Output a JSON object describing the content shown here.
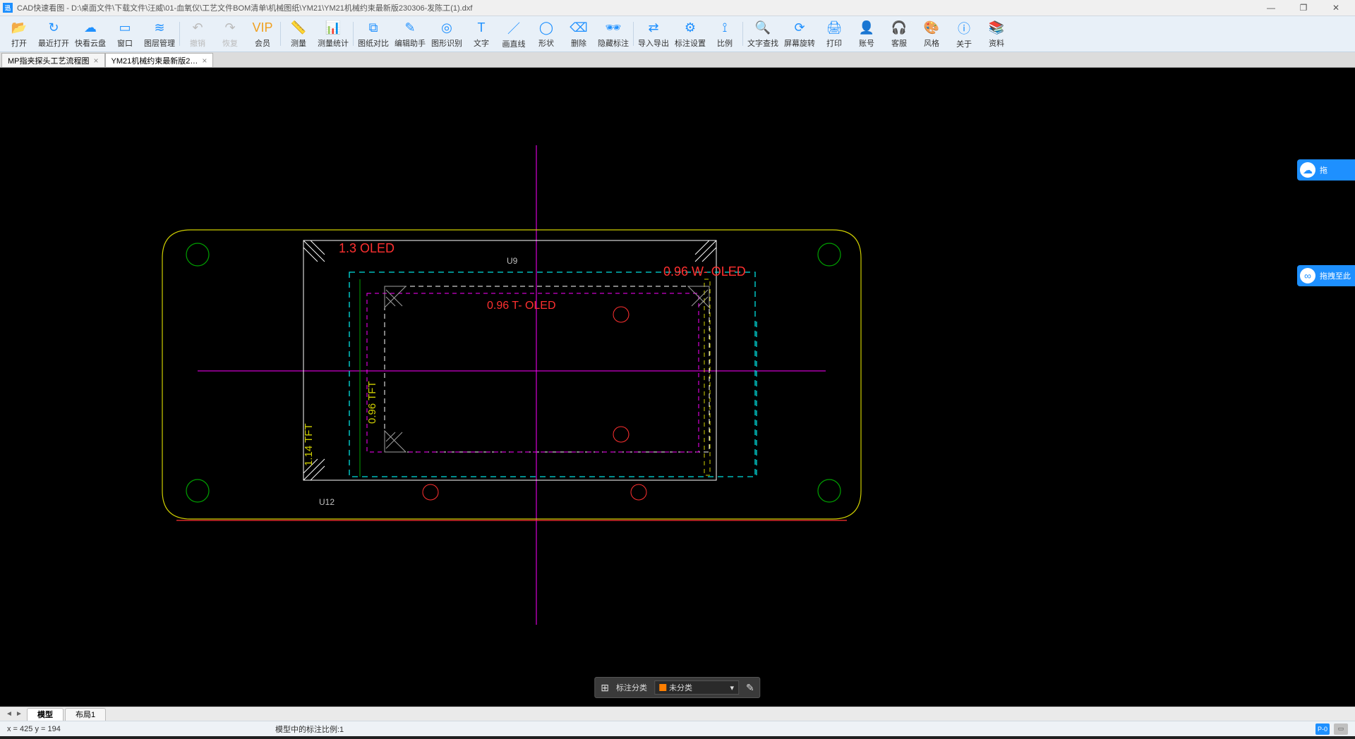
{
  "titlebar": {
    "app_icon_text": "迅",
    "title": "CAD快速看图 - D:\\桌面文件\\下载文件\\汪威\\01-血氧仪\\工艺文件BOM清单\\机械图纸\\YM21\\YM21机械约束最新版230306-发陈工(1).dxf"
  },
  "window_controls": {
    "min": "—",
    "max": "❐",
    "close": "✕"
  },
  "toolbar": [
    {
      "id": "open",
      "label": "打开",
      "glyph": "📂"
    },
    {
      "id": "recent",
      "label": "最近打开",
      "glyph": "↻"
    },
    {
      "id": "cloud",
      "label": "快看云盘",
      "glyph": "☁"
    },
    {
      "id": "window",
      "label": "窗口",
      "glyph": "▭"
    },
    {
      "id": "layers",
      "label": "图层管理",
      "glyph": "≋"
    },
    {
      "sep": true
    },
    {
      "id": "undo",
      "label": "撤销",
      "glyph": "↶",
      "disabled": true
    },
    {
      "id": "redo",
      "label": "恢复",
      "glyph": "↷",
      "disabled": true
    },
    {
      "id": "vip",
      "label": "会员",
      "glyph": "VIP",
      "vip": true
    },
    {
      "sep": true
    },
    {
      "id": "measure",
      "label": "测量",
      "glyph": "📏"
    },
    {
      "id": "measure-stat",
      "label": "测量统计",
      "glyph": "📊"
    },
    {
      "sep": true
    },
    {
      "id": "compare",
      "label": "图纸对比",
      "glyph": "⧉"
    },
    {
      "id": "edit-assist",
      "label": "编辑助手",
      "glyph": "✎"
    },
    {
      "id": "shape-rec",
      "label": "图形识别",
      "glyph": "◎"
    },
    {
      "id": "text",
      "label": "文字",
      "glyph": "T"
    },
    {
      "id": "line",
      "label": "画直线",
      "glyph": "／"
    },
    {
      "id": "shape",
      "label": "形状",
      "glyph": "◯"
    },
    {
      "id": "delete",
      "label": "删除",
      "glyph": "⌫"
    },
    {
      "id": "hide-anno",
      "label": "隐藏标注",
      "glyph": "🕶"
    },
    {
      "sep": true
    },
    {
      "id": "import-export",
      "label": "导入导出",
      "glyph": "⇄"
    },
    {
      "id": "anno-set",
      "label": "标注设置",
      "glyph": "⚙"
    },
    {
      "id": "scale",
      "label": "比例",
      "glyph": "⟟"
    },
    {
      "sep": true
    },
    {
      "id": "text-find",
      "label": "文字查找",
      "glyph": "🔍"
    },
    {
      "id": "rotate",
      "label": "屏幕旋转",
      "glyph": "⟳"
    },
    {
      "id": "print",
      "label": "打印",
      "glyph": "🖨"
    },
    {
      "id": "account",
      "label": "账号",
      "glyph": "👤"
    },
    {
      "id": "support",
      "label": "客服",
      "glyph": "🎧"
    },
    {
      "id": "style",
      "label": "风格",
      "glyph": "🎨"
    },
    {
      "id": "about",
      "label": "关于",
      "glyph": "ⓘ"
    },
    {
      "id": "data",
      "label": "资料",
      "glyph": "📚"
    }
  ],
  "tabs": [
    {
      "title": "MP指夹探头工艺流程图",
      "active": false
    },
    {
      "title": "YM21机械约束最新版2…",
      "active": true
    }
  ],
  "side_widgets": [
    {
      "icon": "☁",
      "text": "拖"
    },
    {
      "icon": "∞",
      "text": "拖拽至此"
    }
  ],
  "bottom_bar": {
    "label": "标注分类",
    "selected": "未分类",
    "swatch": "#ff7f00"
  },
  "layout_tabs": [
    {
      "title": "模型",
      "active": true
    },
    {
      "title": "布局1",
      "active": false
    }
  ],
  "status": {
    "coords": "x = 425  y = 194",
    "scale_text": "模型中的标注比例:1",
    "btn1": "P-0",
    "btn2": "▭"
  },
  "drawing_labels": {
    "l1": "1.3  OLED",
    "l2": "0.96   W- OLED",
    "l3": "0.96   T- OLED",
    "l4": "0.96 TFT",
    "l5": "1.14  TFT",
    "u9": "U9",
    "u12": "U12"
  }
}
